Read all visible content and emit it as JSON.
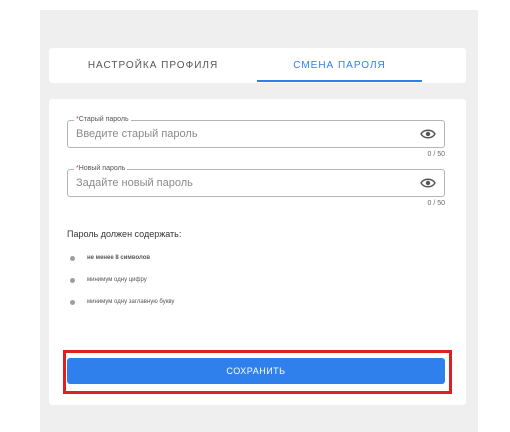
{
  "tabs": [
    {
      "label": "НАСТРОЙКА ПРОФИЛЯ",
      "active": false
    },
    {
      "label": "СМЕНА ПАРОЛЯ",
      "active": true
    }
  ],
  "form": {
    "old_password": {
      "required_mark": "*",
      "label": "Старый пароль",
      "placeholder": "Введите старый пароль",
      "value": "",
      "counter": "0 / 50",
      "icon": "eye-icon"
    },
    "new_password": {
      "required_mark": "*",
      "label": "Новый пароль",
      "placeholder": "Задайте новый пароль",
      "value": "",
      "counter": "0 / 50",
      "icon": "eye-icon"
    },
    "requirements_title": "Пароль должен содержать:",
    "requirements": [
      "не менее 8 символов",
      "минимум одну цифру",
      "минимум одну заглавную букву"
    ],
    "save_label": "СОХРАНИТЬ"
  },
  "colors": {
    "accent": "#2f80ed",
    "highlight": "#e02020",
    "background": "#efefef"
  }
}
